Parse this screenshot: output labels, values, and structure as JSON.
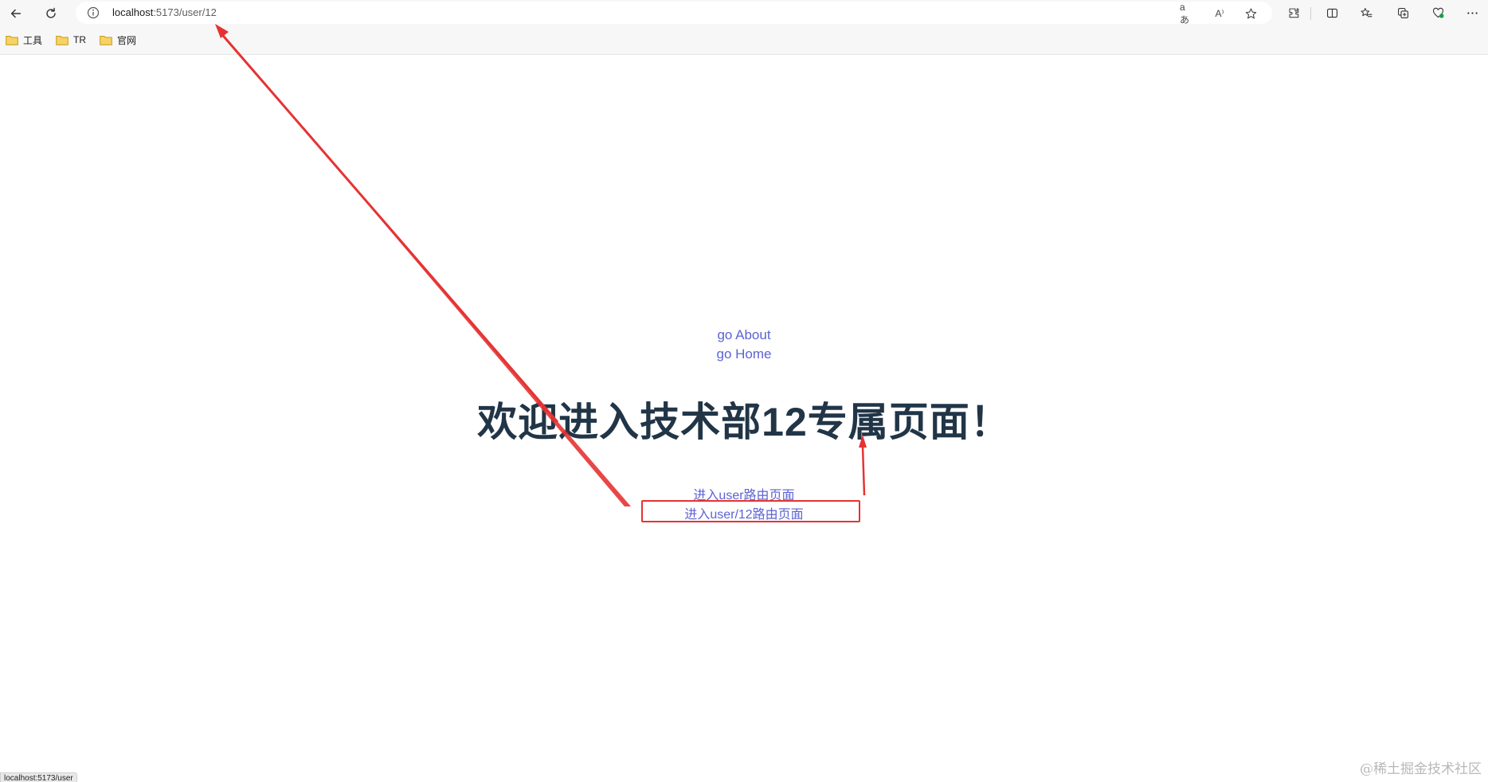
{
  "browser": {
    "url_host": "localhost",
    "url_path": ":5173/user/12",
    "status_text": "localhost:5173/user",
    "translate_icon_text": "aあ",
    "read_aloud_icon_text": "A⁾"
  },
  "bookmarks": [
    {
      "label": "工具"
    },
    {
      "label": "TR"
    },
    {
      "label": "官网"
    }
  ],
  "page": {
    "nav_links": [
      "go About",
      "go Home"
    ],
    "title": "欢迎进入技术部12专属页面！",
    "sub_links": [
      "进入user路由页面",
      "进入user/12路由页面"
    ]
  },
  "watermark": "@稀土掘金技术社区",
  "colors": {
    "link": "#5b63d3",
    "title": "#213547",
    "annotation": "#e53333",
    "folder": "#f2c94c"
  }
}
